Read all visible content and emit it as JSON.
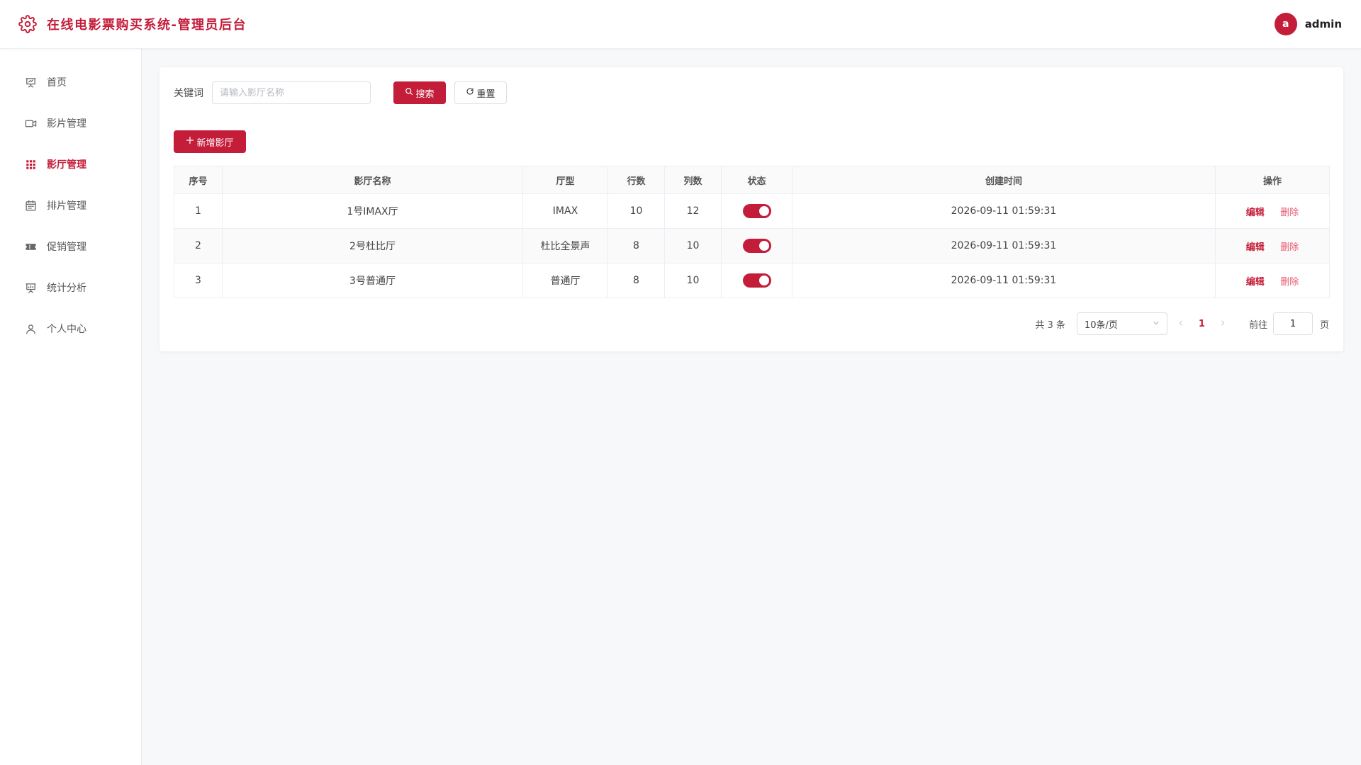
{
  "header": {
    "title": "在线电影票购买系统-管理员后台",
    "user": {
      "avatar_letter": "a",
      "name": "admin"
    }
  },
  "sidebar": {
    "items": [
      {
        "label": "首页",
        "icon": "presentation-icon",
        "active": false
      },
      {
        "label": "影片管理",
        "icon": "video-camera-icon",
        "active": false
      },
      {
        "label": "影厅管理",
        "icon": "grid-icon",
        "active": true
      },
      {
        "label": "排片管理",
        "icon": "calendar-icon",
        "active": false
      },
      {
        "label": "促销管理",
        "icon": "ticket-icon",
        "active": false
      },
      {
        "label": "统计分析",
        "icon": "chart-board-icon",
        "active": false
      },
      {
        "label": "个人中心",
        "icon": "user-icon",
        "active": false
      }
    ]
  },
  "search": {
    "label": "关键词",
    "placeholder": "请输入影厅名称",
    "value": "",
    "search_label": "搜索",
    "reset_label": "重置"
  },
  "toolbar": {
    "add_label": "新增影厅"
  },
  "table": {
    "columns": [
      "序号",
      "影厅名称",
      "厅型",
      "行数",
      "列数",
      "状态",
      "创建时间",
      "操作"
    ],
    "rows": [
      {
        "index": "1",
        "name": "1号IMAX厅",
        "type": "IMAX",
        "rows": "10",
        "cols": "12",
        "status": true,
        "created": "2026-09-11 01:59:31"
      },
      {
        "index": "2",
        "name": "2号杜比厅",
        "type": "杜比全景声",
        "rows": "8",
        "cols": "10",
        "status": true,
        "created": "2026-09-11 01:59:31"
      },
      {
        "index": "3",
        "name": "3号普通厅",
        "type": "普通厅",
        "rows": "8",
        "cols": "10",
        "status": true,
        "created": "2026-09-11 01:59:31"
      }
    ],
    "actions": {
      "edit": "编辑",
      "delete": "删除"
    }
  },
  "pagination": {
    "total_text": "共 3 条",
    "page_size": "10条/页",
    "current_page": "1",
    "goto_label": "前往",
    "goto_value": "1",
    "page_unit": "页"
  },
  "colors": {
    "accent": "#c41d3a",
    "delete_link": "#e7586e"
  }
}
